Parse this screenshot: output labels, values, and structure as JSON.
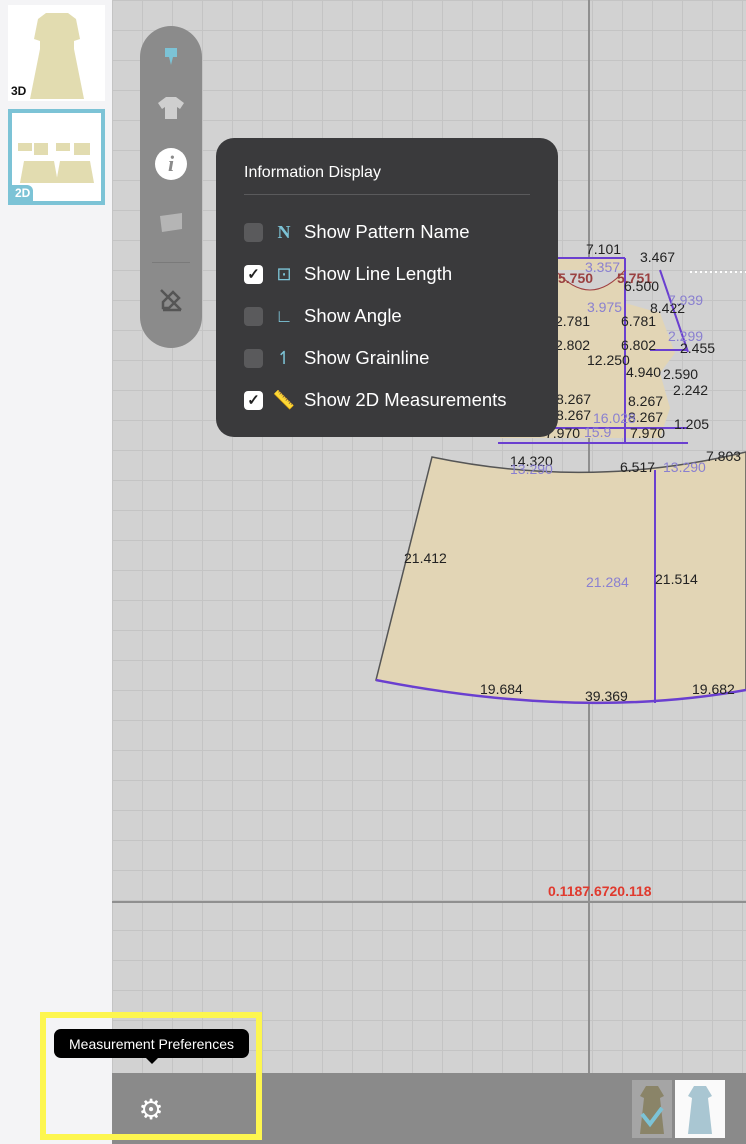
{
  "sidebar": {
    "thumbnails": [
      {
        "label": "3D",
        "selected": false
      },
      {
        "label": "2D",
        "selected": true
      }
    ]
  },
  "toolbar": {
    "items": [
      "pin-icon",
      "garment-icon",
      "info-icon",
      "fabric-icon",
      "edit-off-icon"
    ],
    "active": "info-icon"
  },
  "info_display": {
    "title": "Information Display",
    "options": [
      {
        "label": "Show Pattern Name",
        "checked": false,
        "icon": "N"
      },
      {
        "label": "Show Line Length",
        "checked": true,
        "icon": "line-length-icon"
      },
      {
        "label": "Show Angle",
        "checked": false,
        "icon": "angle-icon"
      },
      {
        "label": "Show Grainline",
        "checked": false,
        "icon": "grainline-icon"
      },
      {
        "label": "Show 2D Measurements",
        "checked": true,
        "icon": "ruler-icon"
      }
    ]
  },
  "measurements": {
    "bodice": [
      "7.101",
      "3.467",
      "5.750",
      "5.751",
      "3.357",
      "6.500",
      "3.975",
      "8.422",
      "7.939",
      "2.781",
      "6.781",
      "2.802",
      "6.802",
      "2.299",
      "2.455",
      "12.250",
      "4.940",
      "2.590",
      "2.242",
      "8.267",
      "8.267",
      "8.267",
      "8.267",
      "1.205",
      "7.970",
      "15.9",
      "7.970",
      "16.028"
    ],
    "skirt": {
      "top_left": "14.320",
      "top_left_purple": "13.290",
      "top_right": "6.517",
      "top_right_purple": "13.290",
      "top_far": "7.803",
      "side_left": "21.412",
      "center_purple": "21.284",
      "center": "21.514",
      "hem_left": "19.684",
      "hem_center": "39.369",
      "hem_right": "19.682"
    },
    "red_readout": "0.1187.6720.118"
  },
  "tooltip": "Measurement Preferences",
  "colors": {
    "accent": "#7cc3d6",
    "highlight": "#fdf64f",
    "pattern_fill": "#e2d5b5",
    "seam": "#6a3fd0"
  }
}
